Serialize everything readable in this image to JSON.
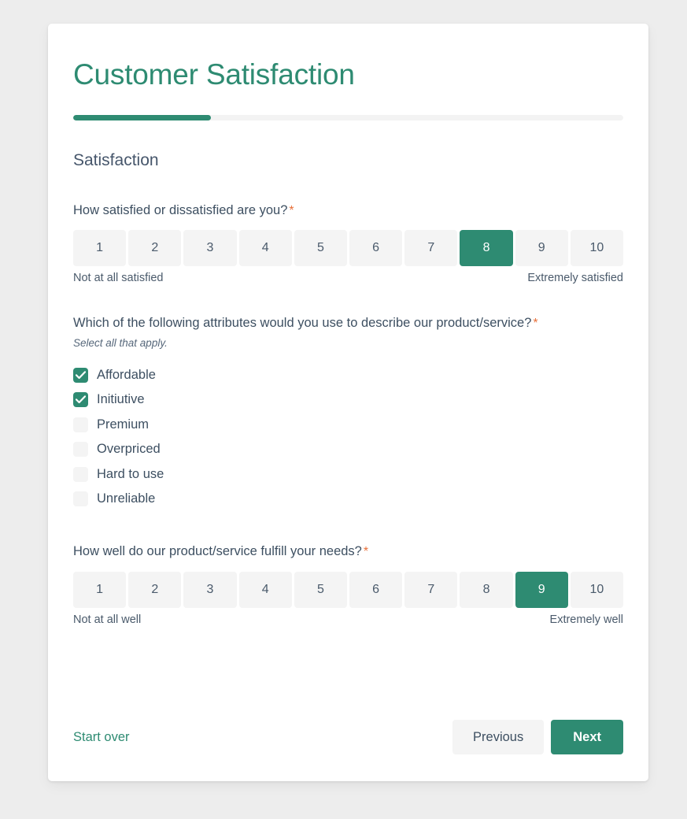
{
  "survey": {
    "title": "Customer Satisfaction",
    "progress_percent": 25,
    "section_title": "Satisfaction"
  },
  "questions": [
    {
      "text": "How satisfied or dissatisfied are you?",
      "required_marker": "*",
      "type": "scale",
      "options": [
        "1",
        "2",
        "3",
        "4",
        "5",
        "6",
        "7",
        "8",
        "9",
        "10"
      ],
      "selected": "8",
      "low_label": "Not at all satisfied",
      "high_label": "Extremely satisfied"
    },
    {
      "text": "Which of the following attributes would you use to describe our product/service?",
      "required_marker": "*",
      "hint": "Select all that apply.",
      "type": "checkbox",
      "options": [
        {
          "label": "Affordable",
          "checked": true
        },
        {
          "label": "Initiutive",
          "checked": true
        },
        {
          "label": "Premium",
          "checked": false
        },
        {
          "label": "Overpriced",
          "checked": false
        },
        {
          "label": "Hard to use",
          "checked": false
        },
        {
          "label": "Unreliable",
          "checked": false
        }
      ]
    },
    {
      "text": "How well do our product/service fulfill your needs?",
      "required_marker": "*",
      "type": "scale",
      "options": [
        "1",
        "2",
        "3",
        "4",
        "5",
        "6",
        "7",
        "8",
        "9",
        "10"
      ],
      "selected": "9",
      "low_label": "Not at all well",
      "high_label": "Extremely well"
    }
  ],
  "footer": {
    "start_over_label": "Start over",
    "previous_label": "Previous",
    "next_label": "Next"
  },
  "colors": {
    "accent": "#2e8b72",
    "required": "#e8703a",
    "control_bg": "#f4f4f4",
    "page_bg": "#ededed"
  }
}
